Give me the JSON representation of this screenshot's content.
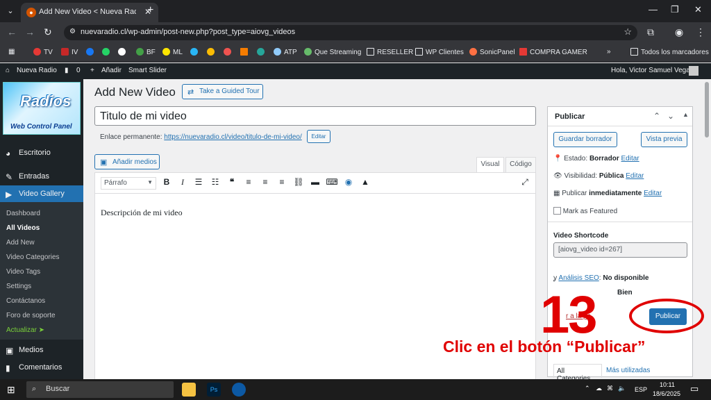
{
  "browser": {
    "tab_title": "Add New Video < Nueva Radio",
    "url": "nuevaradio.cl/wp-admin/post-new.php?post_type=aiovg_videos",
    "bookmarks": [
      "TV",
      "IV",
      "BF",
      "ML",
      "ATP",
      "Que Streaming",
      "RESELLER",
      "WP Clientes",
      "SonicPanel",
      "COMPRA GAMER"
    ],
    "all_bookmarks": "Todos los marcadores"
  },
  "adminbar": {
    "site": "Nueva Radio",
    "comments": "0",
    "new": "Añadir",
    "slider": "Smart Slider",
    "greeting": "Hola, Victor Samuel Vega"
  },
  "sidebar": {
    "logo_text": "Radios",
    "logo_sub": "Web Control Panel",
    "menu": {
      "escritorio": "Escritorio",
      "entradas": "Entradas",
      "video_gallery": "Video Gallery",
      "medios": "Medios",
      "comentarios": "Comentarios"
    },
    "submenu": [
      "Dashboard",
      "All Videos",
      "Add New",
      "Video Categories",
      "Video Tags",
      "Settings",
      "Contáctanos",
      "Foro de soporte",
      "Actualizar ➤"
    ]
  },
  "page": {
    "heading": "Add New Video",
    "guided_tour": "Take a Guided Tour",
    "title_value": "Titulo de mi video",
    "permalink_label": "Enlace permanente:",
    "permalink_url": "https://nuevaradio.cl/video/titulo-de-mi-video/",
    "edit": "Editar",
    "add_media": "Añadir medios",
    "tab_visual": "Visual",
    "tab_code": "Código",
    "format": "Párrafo",
    "content": "Descripción de mi video"
  },
  "publish": {
    "title": "Publicar",
    "save_draft": "Guardar borrador",
    "preview": "Vista previa",
    "status_label": "Estado:",
    "status_value": "Borrador",
    "visibility_label": "Visibilidad:",
    "visibility_value": "Pública",
    "publish_label": "Publicar",
    "publish_value": "inmediatamente",
    "edit": "Editar",
    "featured": "Mark as Featured",
    "shortcode_label": "Video Shortcode",
    "shortcode": "[aiovg_video id=267]",
    "seo_label": "Análisis SEO",
    "seo_value": "No disponible",
    "readability_value": "Bien",
    "trash_partial": "r a la pa",
    "publish_button": "Publicar",
    "all_categories": "All Categories",
    "most_used": "Más utilizadas"
  },
  "annotation": {
    "number": "13",
    "caption": "Clic en el botón “Publicar”"
  },
  "taskbar": {
    "search": "Buscar",
    "lang": "ESP",
    "time": "10:11",
    "date": "18/6/2025"
  },
  "colors": {
    "accent": "#2271b1",
    "annotation": "#e00000",
    "wp_dark": "#1d2327"
  }
}
